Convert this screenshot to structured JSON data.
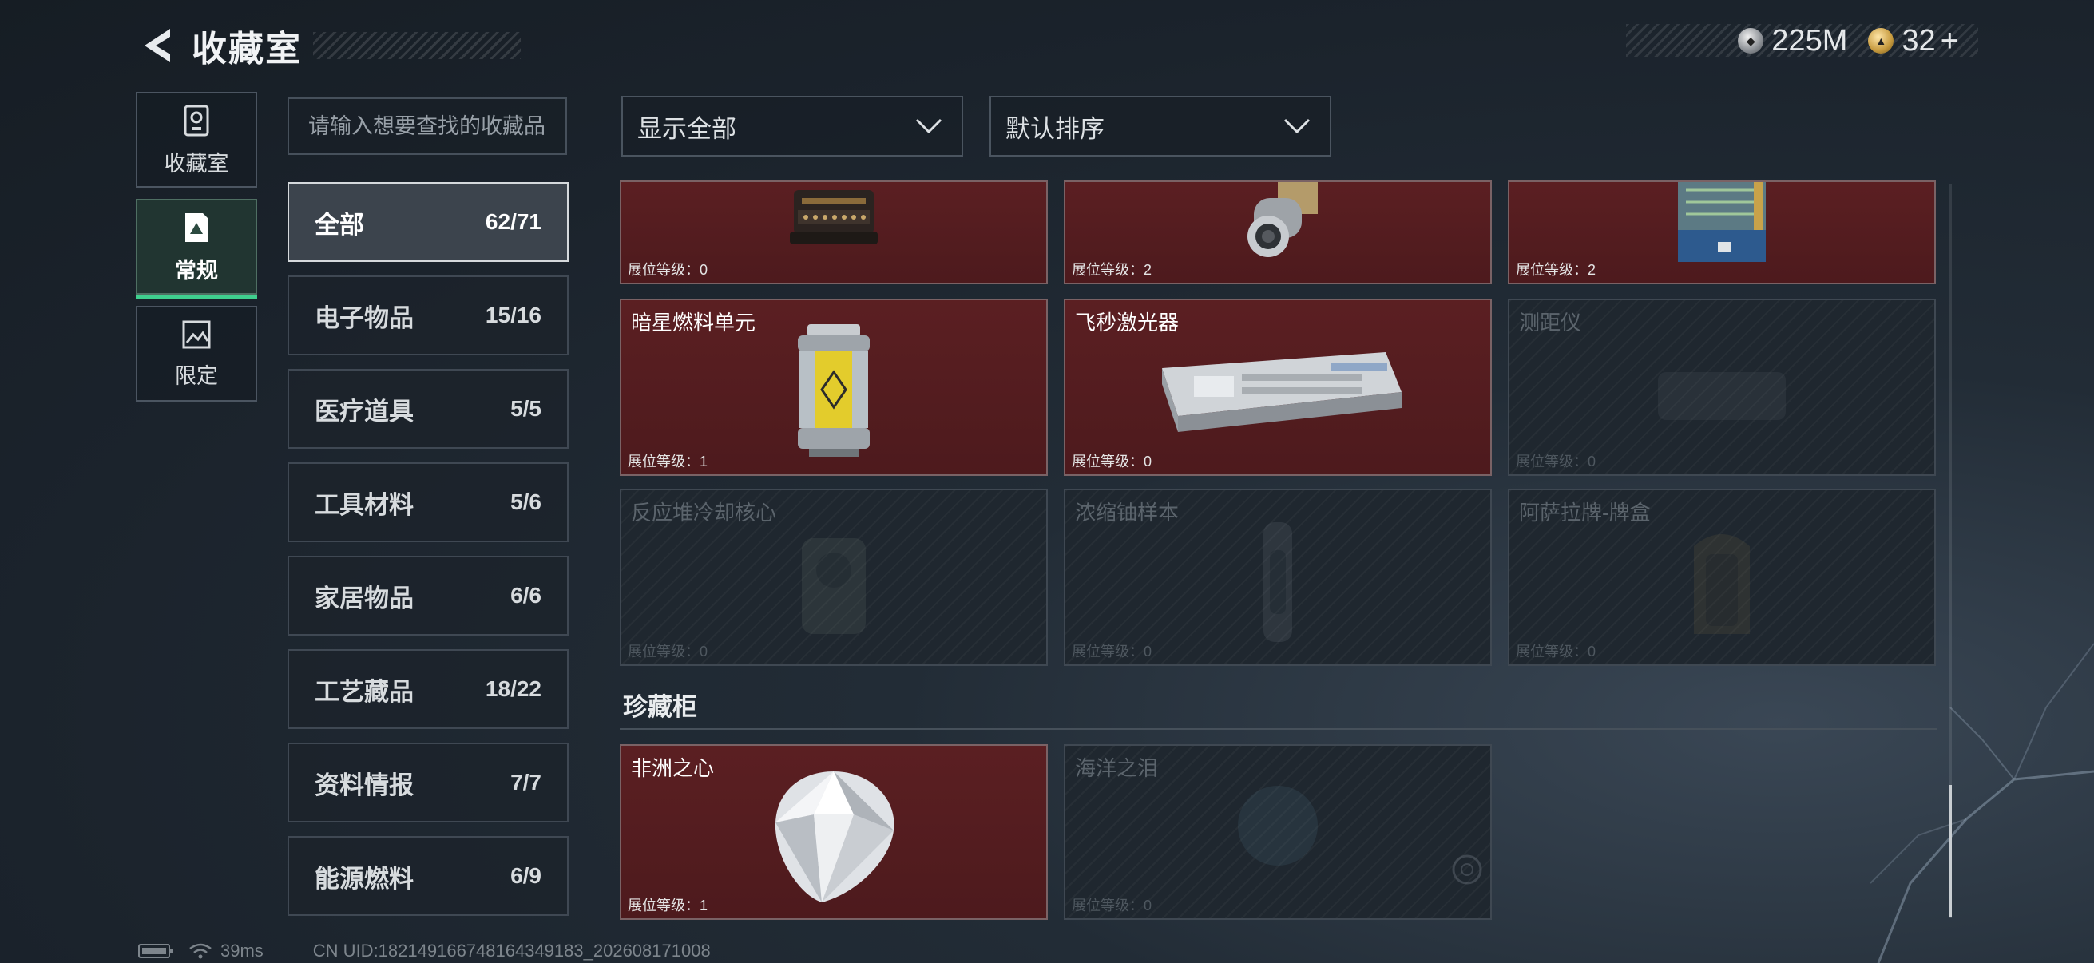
{
  "header": {
    "title": "收藏室"
  },
  "currency": {
    "silver": "225M",
    "gold": "32",
    "plus": "+"
  },
  "nav": [
    {
      "label": "收藏室",
      "icon": "archive-icon",
      "active": false
    },
    {
      "label": "常规",
      "icon": "document-icon",
      "active": true
    },
    {
      "label": "限定",
      "icon": "landscape-icon",
      "active": false
    }
  ],
  "search": {
    "placeholder": "请输入想要查找的收藏品"
  },
  "categories": [
    {
      "name": "全部",
      "count": "62/71",
      "active": true
    },
    {
      "name": "电子物品",
      "count": "15/16"
    },
    {
      "name": "医疗道具",
      "count": "5/5"
    },
    {
      "name": "工具材料",
      "count": "5/6"
    },
    {
      "name": "家居物品",
      "count": "6/6"
    },
    {
      "name": "工艺藏品",
      "count": "18/22"
    },
    {
      "name": "资料情报",
      "count": "7/7"
    },
    {
      "name": "能源燃料",
      "count": "6/9"
    }
  ],
  "filters": {
    "show": "显示全部",
    "sort": "默认排序"
  },
  "items": [
    {
      "name": "",
      "level": "展位等级：0",
      "owned": true,
      "icon": "typewriter-icon"
    },
    {
      "name": "",
      "level": "展位等级：2",
      "owned": true,
      "icon": "lens-device-icon"
    },
    {
      "name": "",
      "level": "展位等级：2",
      "owned": true,
      "icon": "circuit-device-icon"
    },
    {
      "name": "暗星燃料单元",
      "level": "展位等级：1",
      "owned": true,
      "icon": "fuel-canister-icon"
    },
    {
      "name": "飞秒激光器",
      "level": "展位等级：0",
      "owned": true,
      "icon": "laser-device-icon"
    },
    {
      "name": "测距仪",
      "level": "展位等级：0",
      "owned": false,
      "icon": "rangefinder-icon"
    },
    {
      "name": "反应堆冷却核心",
      "level": "展位等级：0",
      "owned": false,
      "icon": "reactor-core-icon"
    },
    {
      "name": "浓缩铀样本",
      "level": "展位等级：0",
      "owned": false,
      "icon": "uranium-sample-icon"
    },
    {
      "name": "阿萨拉牌-牌盒",
      "level": "展位等级：0",
      "owned": false,
      "icon": "card-box-icon"
    }
  ],
  "section": {
    "title": "珍藏柜"
  },
  "treasures": [
    {
      "name": "非洲之心",
      "level": "展位等级：1",
      "owned": true,
      "icon": "diamond-icon"
    },
    {
      "name": "海洋之泪",
      "level": "展位等级：0",
      "owned": false,
      "icon": "gem-icon"
    }
  ],
  "footer": {
    "ping": "39ms",
    "uid": "CN UID:1821491667481643491­83_202608171008"
  }
}
